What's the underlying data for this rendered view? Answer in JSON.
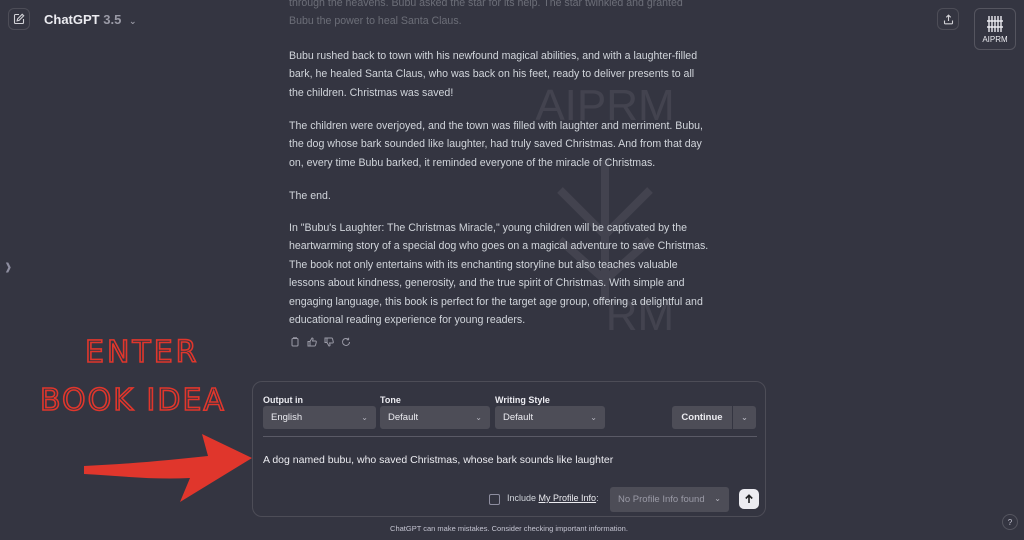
{
  "header": {
    "model_name": "ChatGPT",
    "model_version": "3.5",
    "aiprm_logo_label": "AIPRM",
    "icons": [
      "edit-icon",
      "chevron-down-icon",
      "share-icon",
      "aiprm-logo-icon"
    ]
  },
  "watermark": {
    "top": "AIPRM",
    "bottom": "RM"
  },
  "chat": {
    "paragraphs": [
      "through the heavens. Bubu asked the star for its help. The star twinkled and granted Bubu the power to heal Santa Claus.",
      "Bubu rushed back to town with his newfound magical abilities, and with a laughter-filled bark, he healed Santa Claus, who was back on his feet, ready to deliver presents to all the children. Christmas was saved!",
      "The children were overjoyed, and the town was filled with laughter and merriment. Bubu, the dog whose bark sounded like laughter, had truly saved Christmas. And from that day on, every time Bubu barked, it reminded everyone of the miracle of Christmas.",
      "The end.",
      "In \"Bubu's Laughter: The Christmas Miracle,\" young children will be captivated by the heartwarming story of a special dog who goes on a magical adventure to save Christmas. The book not only entertains with its enchanting storyline but also teaches valuable lessons about kindness, generosity, and the true spirit of Christmas. With simple and engaging language, this book is perfect for the target age group, offering a delightful and educational reading experience for young readers."
    ],
    "action_icons": [
      "copy-icon",
      "thumbs-up-icon",
      "thumbs-down-icon",
      "regenerate-icon"
    ]
  },
  "annotation": {
    "line1": "ENTER",
    "line2": "BOOK IDEA",
    "color": "#e0362c"
  },
  "prompt_panel": {
    "output_label": "Output in",
    "output_value": "English",
    "tone_label": "Tone",
    "tone_value": "Default",
    "style_label": "Writing Style",
    "style_value": "Default",
    "continue_label": "Continue",
    "prompt_text": "A dog named bubu, who saved Christmas, whose bark sounds like laughter",
    "include_label": "Include",
    "profile_link": "My Profile Info",
    "profile_colon": ":",
    "profile_value": "No Profile Info found"
  },
  "footer": {
    "disclaimer": "ChatGPT can make mistakes. Consider checking important information.",
    "help": "?"
  },
  "colors": {
    "background": "#343541",
    "panel_border": "#4d4d57",
    "select_bg": "#4d4d57",
    "send_bg": "#ececf1"
  }
}
